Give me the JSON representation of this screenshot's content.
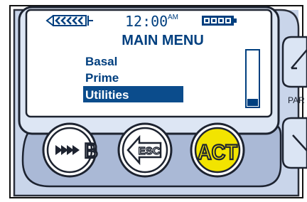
{
  "status": {
    "time": "12:00",
    "meridiem": "AM",
    "reservoir_icon": "reservoir-level-icon",
    "battery_icon": "battery-full-icon"
  },
  "screen": {
    "title": "MAIN MENU",
    "menu_items": [
      {
        "label": "Basal",
        "selected": false
      },
      {
        "label": "Prime",
        "selected": false
      },
      {
        "label": "Utilities",
        "selected": true
      }
    ],
    "scroll_position": 1.0
  },
  "buttons": {
    "bolus_label": "B",
    "bolus_icon": "bolus-arrows-icon",
    "esc_label": "ESC",
    "act_label": "ACT",
    "side_label": "PAR"
  },
  "colors": {
    "lcd_text": "#003f7f",
    "selection_bg": "#0b4c8c",
    "act_fill": "#f2e400",
    "panel": "#c9d5ea"
  }
}
